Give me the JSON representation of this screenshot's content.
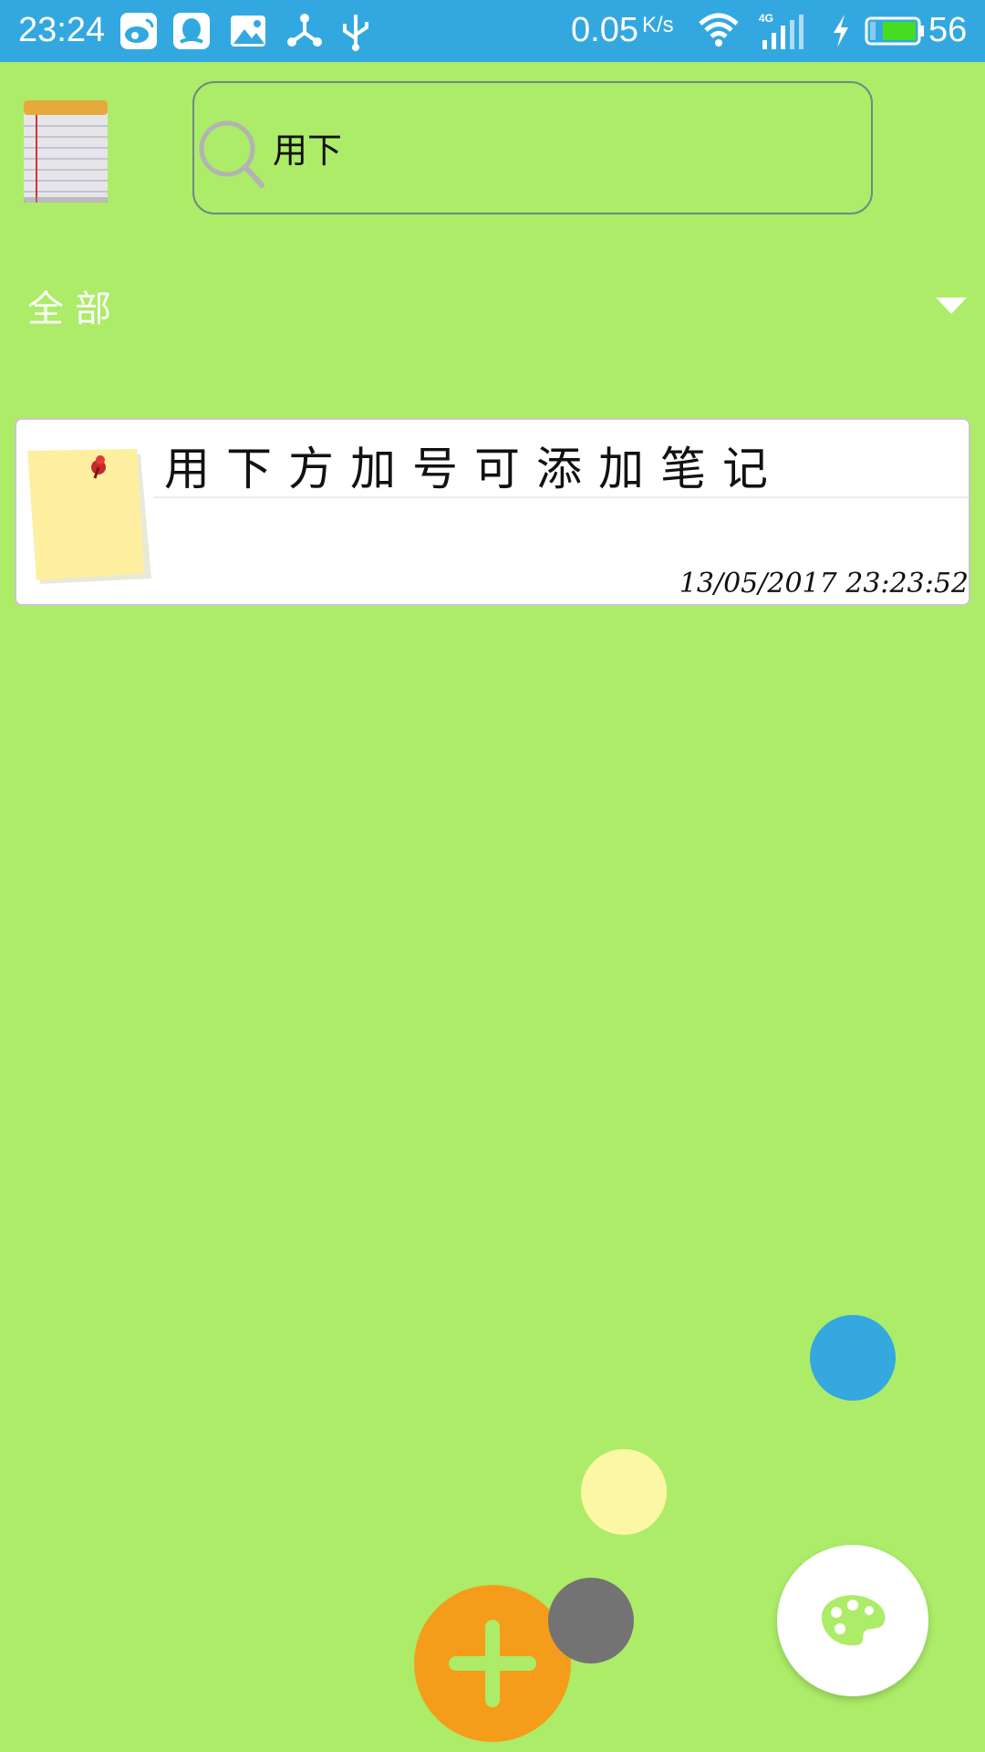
{
  "status_bar": {
    "time": "23:24",
    "network_speed": "0.05",
    "network_speed_unit": "K/s",
    "network_type": "4G",
    "battery_percent": "56",
    "icons": [
      "weibo-icon",
      "qq-icon",
      "image-icon",
      "share-icon",
      "usb-icon",
      "wifi-icon",
      "signal-icon",
      "charging-icon",
      "battery-icon"
    ]
  },
  "search": {
    "value": "用下"
  },
  "category": {
    "selected": "全部"
  },
  "notes": [
    {
      "title": "用下方加号可添加笔记",
      "timestamp": "13/05/2017 23:23:52"
    }
  ],
  "colors": {
    "background": "#acec68",
    "status_bar": "#33a8e0",
    "dot_blue": "#35a8df",
    "dot_yellow": "#fbf7a4",
    "dot_gray": "#737373",
    "add_button": "#f59c1a",
    "palette_icon": "#acec68"
  }
}
